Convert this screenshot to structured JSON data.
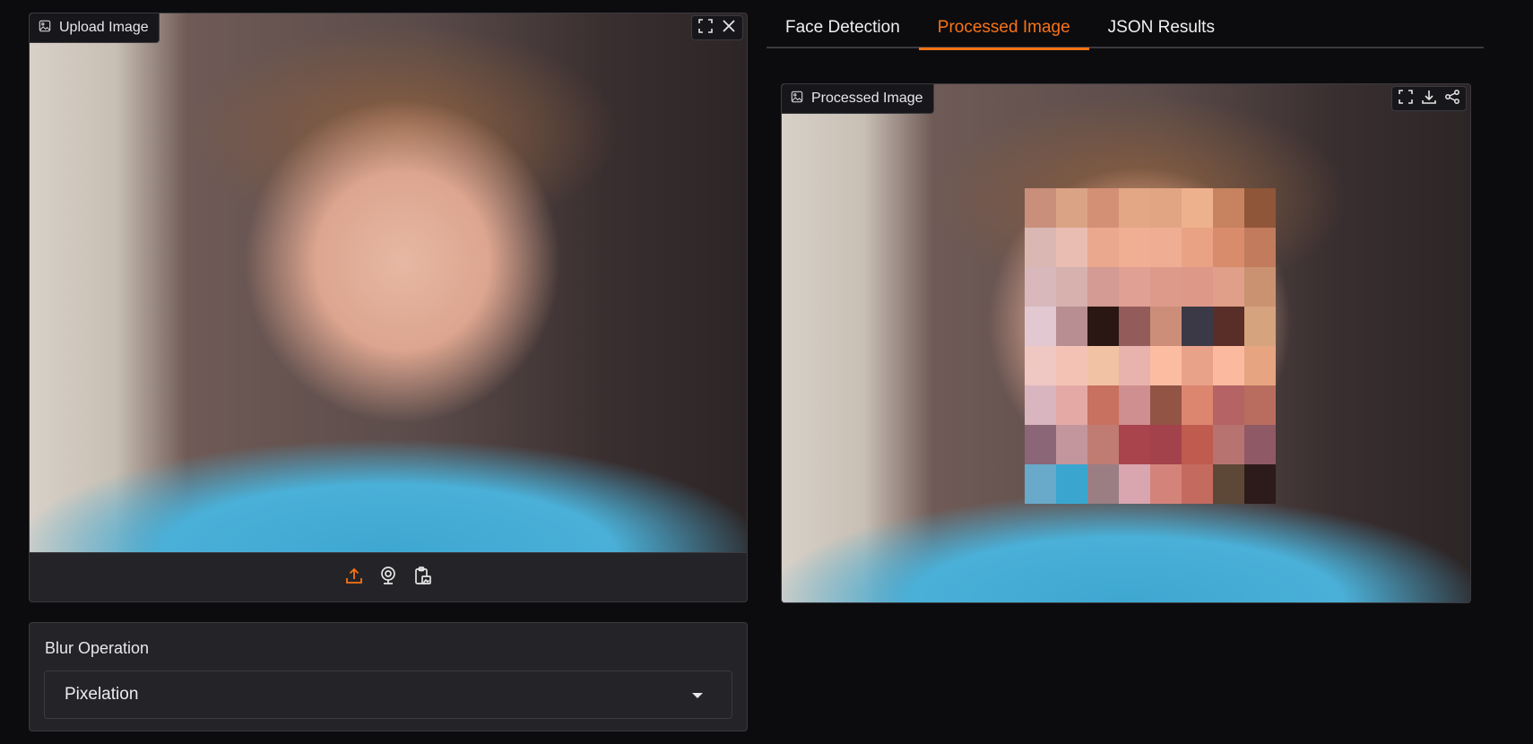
{
  "upload": {
    "badge_label": "Upload Image",
    "icons": [
      "image-icon",
      "fullscreen-icon",
      "close-icon",
      "upload-icon",
      "webcam-icon",
      "clipboard-icon"
    ],
    "accent_color": "#f97316"
  },
  "tabs": {
    "items": [
      {
        "label": "Face Detection"
      },
      {
        "label": "Processed Image"
      },
      {
        "label": "JSON Results"
      }
    ],
    "active_index": 1,
    "active_color": "#f97316"
  },
  "processed": {
    "badge_label": "Processed Image",
    "icons": [
      "image-icon",
      "fullscreen-icon",
      "download-icon",
      "share-icon"
    ],
    "pixel_colors": [
      "#c98f7a",
      "#dba386",
      "#d39075",
      "#e3a786",
      "#e1a583",
      "#eeb18d",
      "#c7825f",
      "#8f5639",
      "#dab7b3",
      "#e9bdb2",
      "#eaa88f",
      "#f0ae93",
      "#efae93",
      "#eaa285",
      "#d98c6b",
      "#c27b5c",
      "#d8b8bb",
      "#d6b1ae",
      "#d49a94",
      "#e1a094",
      "#dd9a8a",
      "#dd9888",
      "#e09f88",
      "#cb9271",
      "#e2c8d0",
      "#b98e93",
      "#2a1613",
      "#935c5b",
      "#cc8e79",
      "#3c3946",
      "#5a2e28",
      "#d6a37f",
      "#efc7c3",
      "#f3c2b4",
      "#f2c2a5",
      "#e7b3ac",
      "#fcbca2",
      "#e9a28a",
      "#fbb9a0",
      "#e6a580",
      "#d9b5bf",
      "#e4a9a5",
      "#c87161",
      "#cf8f90",
      "#925445",
      "#dc8670",
      "#b56364",
      "#b96d5f",
      "#8a6677",
      "#c2969c",
      "#c07b72",
      "#a9444c",
      "#a3424b",
      "#bf5b4f",
      "#b67370",
      "#8f5965",
      "#69a9c9",
      "#3aa6cf",
      "#9b7d84",
      "#d9a5ae",
      "#d4837a",
      "#c46a5f",
      "#5d4837",
      "#2c1b1a"
    ]
  },
  "blur": {
    "label": "Blur Operation",
    "selected": "Pixelation"
  }
}
